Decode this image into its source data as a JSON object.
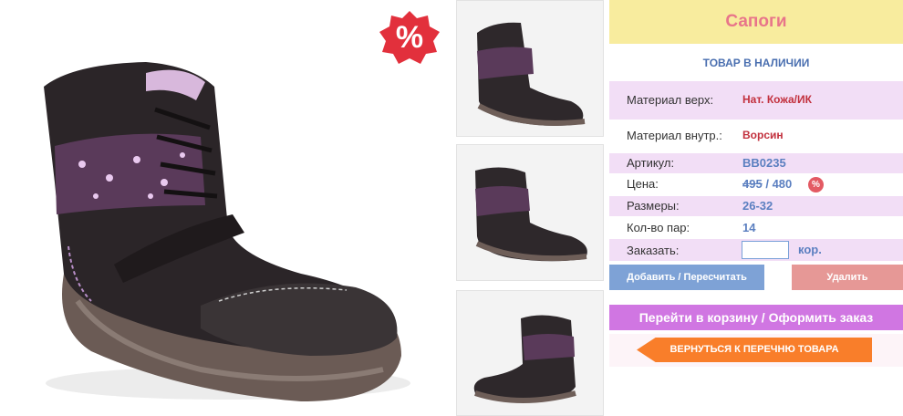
{
  "badge": {
    "sale_symbol": "%"
  },
  "product": {
    "title": "Сапоги",
    "stock_status": "ТОВАР В НАЛИЧИИ"
  },
  "specs": {
    "material_top_label": "Материал верх:",
    "material_top_value": "Нат. Кожа/ИК",
    "material_inner_label": "Материал внутр.:",
    "material_inner_value": "Ворсин",
    "article_label": "Артикул:",
    "article_value": "BB0235",
    "price_label": "Цена:",
    "price_old": "495",
    "price_separator": "/",
    "price_new": "480",
    "price_badge": "%",
    "sizes_label": "Размеры:",
    "sizes_value": "26-32",
    "qty_label": "Кол-во пар:",
    "qty_value": "14",
    "order_label": "Заказать:",
    "order_input_value": "",
    "order_unit": "кор."
  },
  "buttons": {
    "add": "Добавить / Пересчитать",
    "delete": "Удалить",
    "cart": "Перейти в корзину / Оформить заказ",
    "back": "ВЕРНУТЬСЯ К ПЕРЕЧНЮ ТОВАРА"
  },
  "colors": {
    "title_bg": "#f8ec9e",
    "title_text": "#e8758a",
    "accent_blue": "#5b7fc0",
    "row_pink": "#f2def6",
    "cart_purple": "#d076e2",
    "back_orange": "#f97e2a"
  }
}
